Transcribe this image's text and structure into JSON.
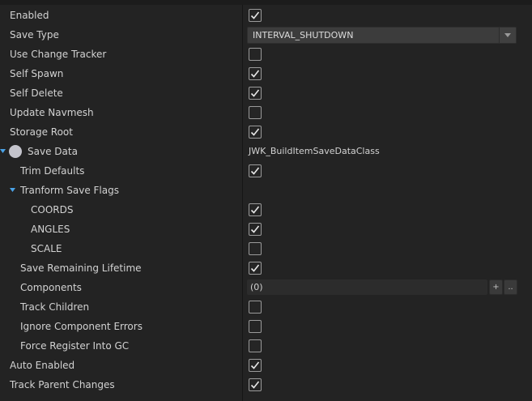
{
  "properties": {
    "enabled": {
      "label": "Enabled",
      "checked": true
    },
    "save_type": {
      "label": "Save Type",
      "value": "INTERVAL_SHUTDOWN"
    },
    "use_change_tracker": {
      "label": "Use Change Tracker",
      "checked": false
    },
    "self_spawn": {
      "label": "Self Spawn",
      "checked": true
    },
    "self_delete": {
      "label": "Self Delete",
      "checked": true
    },
    "update_navmesh": {
      "label": "Update Navmesh",
      "checked": false
    },
    "storage_root": {
      "label": "Storage Root",
      "checked": true
    },
    "save_data": {
      "label": "Save Data",
      "value": "JWK_BuildItemSaveDataClass"
    },
    "trim_defaults": {
      "label": "Trim Defaults",
      "checked": true
    },
    "transform_save_flags": {
      "label": "Tranform Save Flags"
    },
    "coords": {
      "label": "COORDS",
      "checked": true
    },
    "angles": {
      "label": "ANGLES",
      "checked": true
    },
    "scale": {
      "label": "SCALE",
      "checked": false
    },
    "save_remaining_lifetime": {
      "label": "Save Remaining Lifetime",
      "checked": true
    },
    "components": {
      "label": "Components",
      "value": "(0)",
      "add_label": "+",
      "more_label": ".."
    },
    "track_children": {
      "label": "Track Children",
      "checked": false
    },
    "ignore_component_errors": {
      "label": "Ignore Component Errors",
      "checked": false
    },
    "force_register_into_gc": {
      "label": "Force Register Into GC",
      "checked": false
    },
    "auto_enabled": {
      "label": "Auto Enabled",
      "checked": true
    },
    "track_parent_changes": {
      "label": "Track Parent Changes",
      "checked": true
    }
  },
  "colors": {
    "background": "#232323",
    "text": "#d2d2d2",
    "expand_arrow": "#4aa3e8"
  },
  "icons": {
    "checkmark": "checkmark-icon",
    "dropdown": "chevron-down-icon",
    "expand": "triangle-down-icon",
    "save_data": "circle-icon"
  }
}
